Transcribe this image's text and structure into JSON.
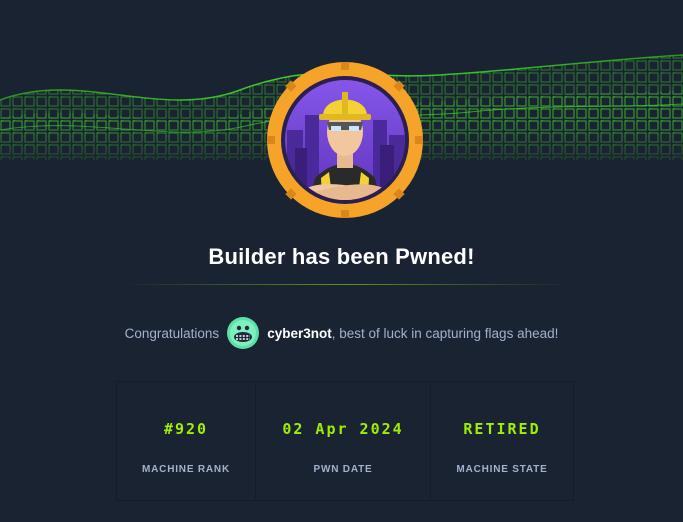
{
  "header": {
    "title": "Builder has been Pwned!"
  },
  "congrats": {
    "prefix": "Congratulations",
    "username": "cyber3not",
    "suffix": ", best of luck in capturing flags ahead!"
  },
  "stats": [
    {
      "value": "#920",
      "label": "MACHINE RANK"
    },
    {
      "value": "02 Apr 2024",
      "label": "PWN DATE"
    },
    {
      "value": "RETIRED",
      "label": "MACHINE STATE"
    }
  ],
  "colors": {
    "background": "#1a2332",
    "accent_green": "#9fef00",
    "badge_ring": "#f6a32a",
    "badge_inner": "#7b4fd6",
    "muted_text": "#a4b1cd",
    "title_text": "#ffffff"
  },
  "icons": {
    "badge": "machine-avatar-builder",
    "avatar": "user-avatar-icon",
    "banner": "green-cube-wave-banner"
  }
}
